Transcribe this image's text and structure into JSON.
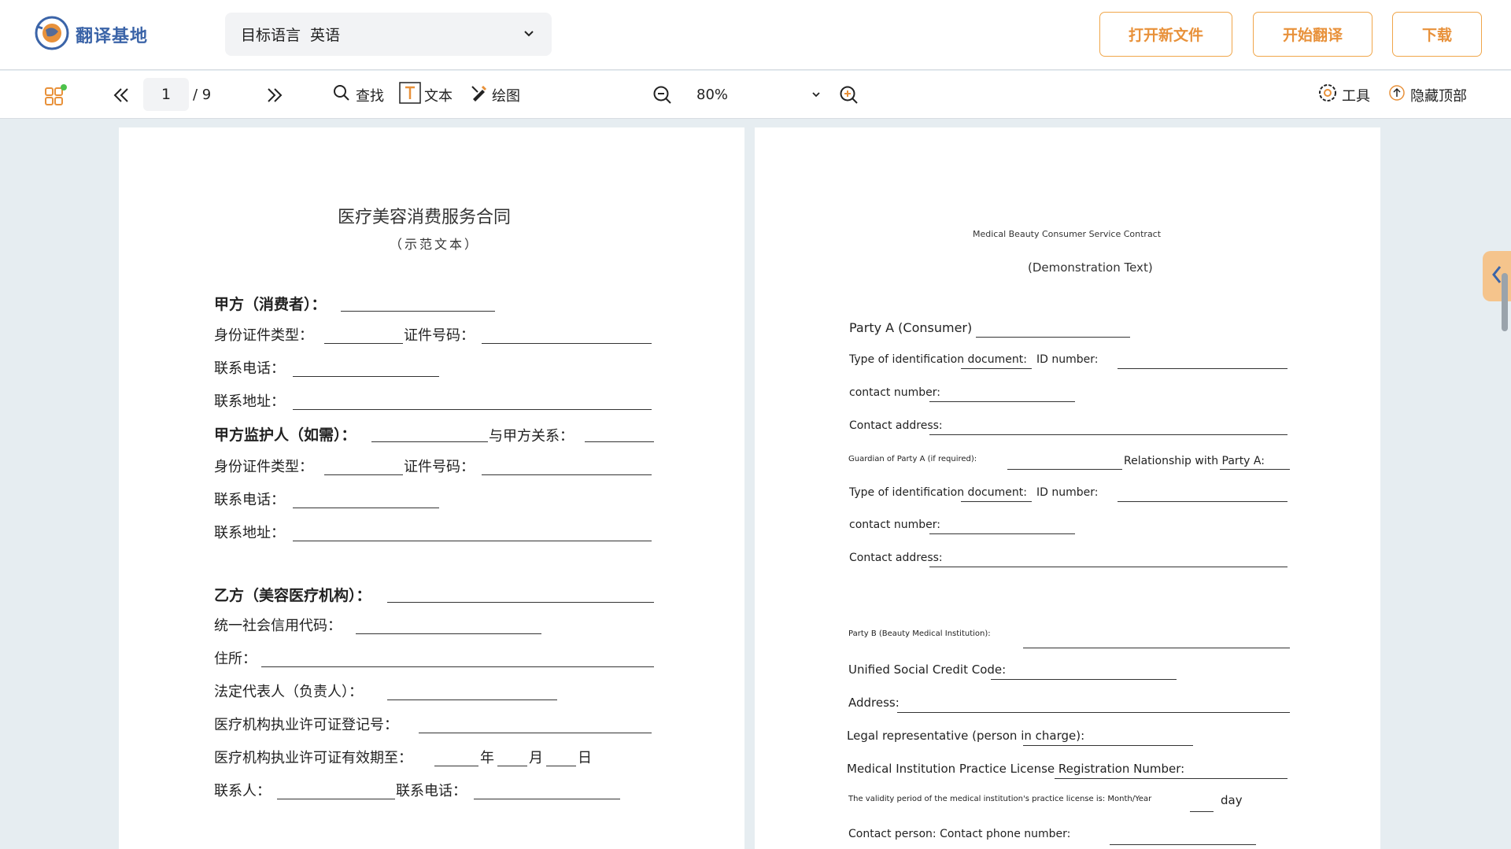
{
  "header": {
    "app_name": "翻译基地",
    "lang_label": "目标语言",
    "lang_value": "英语",
    "btn_open": "打开新文件",
    "btn_translate": "开始翻译",
    "btn_download": "下载"
  },
  "toolbar": {
    "current_page": "1",
    "total_pages": "/ 9",
    "find": "查找",
    "text": "文本",
    "draw": "绘图",
    "zoom": "80%",
    "tools": "工具",
    "hide_top": "隐藏顶部"
  },
  "left_page": {
    "title": "医疗美容消费服务合同",
    "subtitle": "（示范文本）",
    "party_a": "甲方（消费者）：",
    "id_type": "身份证件类型：",
    "id_num": "证件号码：",
    "phone": "联系电话：",
    "address": "联系地址：",
    "guardian": "甲方监护人（如需）：",
    "relation": "与甲方关系：",
    "id_type2": "身份证件类型：",
    "id_num2": "证件号码：",
    "phone2": "联系电话：",
    "address2": "联系地址：",
    "party_b": "乙方（美容医疗机构）：",
    "credit_code": "统一社会信用代码：",
    "residence": "住所：",
    "legal_rep": "法定代表人（负责人）：",
    "license_no": "医疗机构执业许可证登记号：",
    "license_valid": "医疗机构执业许可证有效期至：",
    "year": "年",
    "month": "月",
    "day": "日",
    "contact": "联系人：",
    "contact_phone": "联系电话："
  },
  "right_page": {
    "title": "Medical Beauty Consumer Service Contract",
    "subtitle": "(Demonstration Text)",
    "party_a": "Party A (Consumer)",
    "id_type": "Type of identification document:",
    "id_num": "ID number:",
    "phone": "contact number:",
    "address": "Contact address:",
    "guardian": "Guardian of Party A (if required):",
    "relation": "Relationship with Party A:",
    "id_type2": "Type of identification document:",
    "id_num2": "ID number:",
    "phone2": "contact number:",
    "address2": "Contact address:",
    "party_b": "Party B (Beauty Medical Institution):",
    "credit_code": "Unified Social Credit Code:",
    "residence": "Address:",
    "legal_rep": "Legal representative (person in charge):",
    "license_no": "Medical Institution Practice License Registration Number:",
    "license_valid": "The validity period of the medical institution's practice license is: Month/Year",
    "day": "day",
    "contact": "Contact person: Contact phone number:"
  }
}
